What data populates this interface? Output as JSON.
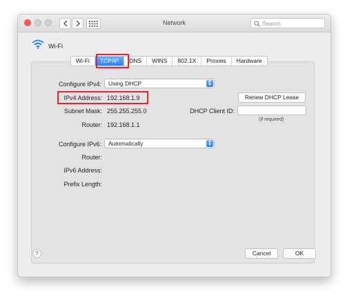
{
  "window": {
    "title": "Network"
  },
  "search": {
    "placeholder": "Search"
  },
  "interface": {
    "name": "Wi-Fi",
    "icon": "wifi-icon"
  },
  "tabs": [
    {
      "label": "Wi-Fi"
    },
    {
      "label": "TCP/IP",
      "active": true
    },
    {
      "label": "DNS"
    },
    {
      "label": "WINS"
    },
    {
      "label": "802.1X"
    },
    {
      "label": "Proxies"
    },
    {
      "label": "Hardware"
    }
  ],
  "ipv4": {
    "configure_label": "Configure IPv4:",
    "configure_value": "Using DHCP",
    "address_label": "IPv4 Address:",
    "address_value": "192.168.1.9",
    "subnet_label": "Subnet Mask:",
    "subnet_value": "255.255.255.0",
    "router_label": "Router:",
    "router_value": "192.168.1.1",
    "renew_button": "Renew DHCP Lease",
    "client_id_label": "DHCP Client ID:",
    "client_id_value": "",
    "client_id_hint": "(If required)"
  },
  "ipv6": {
    "configure_label": "Configure IPv6:",
    "configure_value": "Automatically",
    "router_label": "Router:",
    "address_label": "IPv6 Address:",
    "prefix_label": "Prefix Length:"
  },
  "footer": {
    "help": "?",
    "cancel": "Cancel",
    "ok": "OK"
  },
  "colors": {
    "accent": "#2f7ff2",
    "highlight": "#e5232a"
  }
}
